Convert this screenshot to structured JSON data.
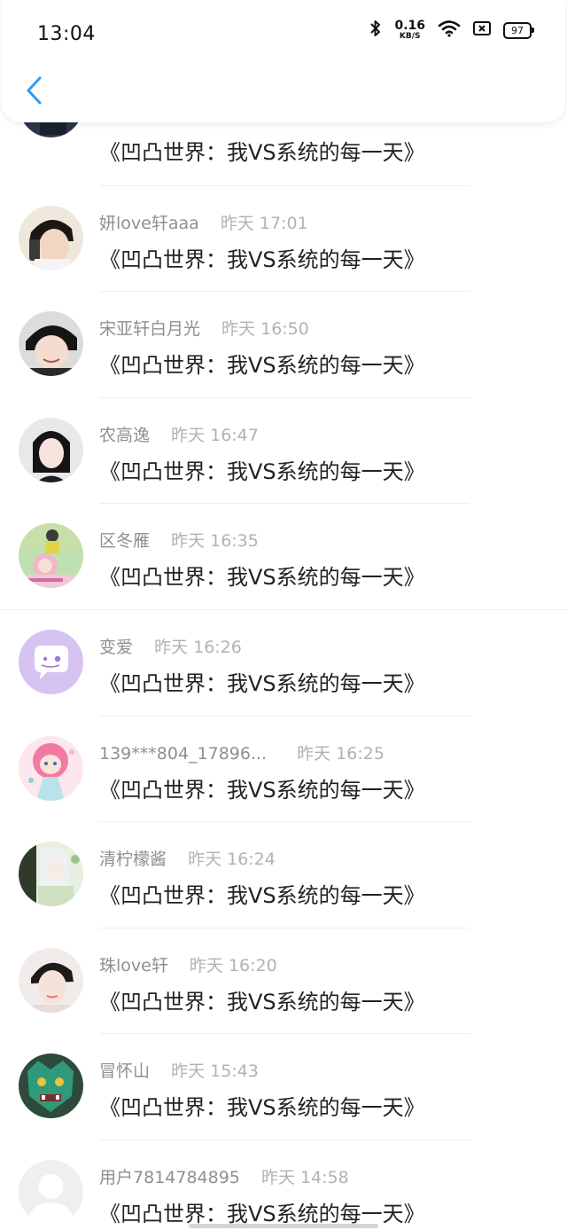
{
  "status_bar": {
    "time": "13:04",
    "net_speed_value": "0.16",
    "net_speed_unit": "KB/S",
    "battery": "97"
  },
  "nav": {
    "back_icon": "chevron-left-icon",
    "accent": "#2f9bf0"
  },
  "messages": [
    {
      "name": "",
      "time": "",
      "text": "《凹凸世界：我VS系统的每一天》",
      "avatar": "anime-girl-avatar"
    },
    {
      "name": "妍love轩aaa",
      "time": "昨天 17:01",
      "text": "《凹凸世界：我VS系统的每一天》",
      "avatar": "boy-phone-avatar"
    },
    {
      "name": "宋亚轩白月光",
      "time": "昨天 16:50",
      "text": "《凹凸世界：我VS系统的每一天》",
      "avatar": "boy-smile-avatar"
    },
    {
      "name": "农高逸",
      "time": "昨天 16:47",
      "text": "《凹凸世界：我VS系统的每一天》",
      "avatar": "girl-bob-avatar"
    },
    {
      "name": "区冬雁",
      "time": "昨天 16:35",
      "text": "《凹凸世界：我VS系统的每一天》",
      "avatar": "collage-avatar"
    },
    {
      "name": "变爱",
      "time": "昨天 16:26",
      "text": "《凹凸世界：我VS系统的每一天》",
      "avatar": "chat-bubble-avatar"
    },
    {
      "name": "139***804_17896...",
      "time": "昨天 16:25",
      "text": "《凹凸世界：我VS系统的每一天》",
      "avatar": "doll-avatar"
    },
    {
      "name": "清柠檬酱",
      "time": "昨天 16:24",
      "text": "《凹凸世界：我VS系统的每一天》",
      "avatar": "anime-green-avatar"
    },
    {
      "name": "珠love轩",
      "time": "昨天 16:20",
      "text": "《凹凸世界：我VS系统的每一天》",
      "avatar": "boy-portrait-avatar"
    },
    {
      "name": "冒怀山",
      "time": "昨天 15:43",
      "text": "《凹凸世界：我VS系统的每一天》",
      "avatar": "dragon-mask-avatar"
    },
    {
      "name": "用户7814784895",
      "time": "昨天 14:58",
      "text": "《凹凸世界：我VS系统的每一天》",
      "avatar": "default-user-avatar"
    }
  ],
  "colors": {
    "name_text": "#8f8f8f",
    "time_text": "#b2b2b2",
    "message_text": "#222222",
    "chat_avatar_bg": "#d7c3f2"
  }
}
